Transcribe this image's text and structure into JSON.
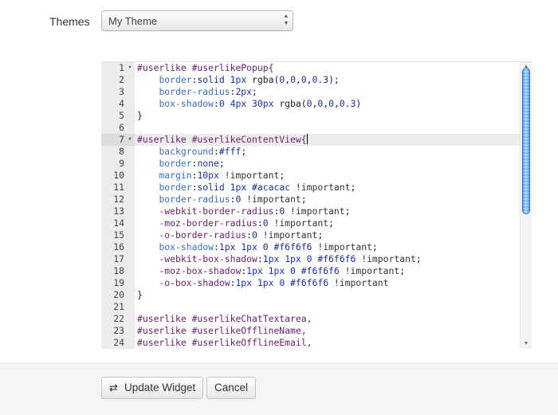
{
  "themes": {
    "label": "Themes",
    "selected": "My Theme"
  },
  "editor": {
    "lines": [
      {
        "num": "1",
        "fold": true,
        "tokens": [
          {
            "t": "sel",
            "v": "#userlike #userlikePopup{"
          }
        ]
      },
      {
        "num": "2",
        "tokens": [
          {
            "t": "plain",
            "v": "    "
          },
          {
            "t": "prop",
            "v": "border"
          },
          {
            "t": "plain",
            "v": ":"
          },
          {
            "t": "val",
            "v": "solid"
          },
          {
            "t": "plain",
            "v": " "
          },
          {
            "t": "num",
            "v": "1px"
          },
          {
            "t": "plain",
            "v": " rgba("
          },
          {
            "t": "num",
            "v": "0"
          },
          {
            "t": "plain",
            "v": ","
          },
          {
            "t": "num",
            "v": "0"
          },
          {
            "t": "plain",
            "v": ","
          },
          {
            "t": "num",
            "v": "0"
          },
          {
            "t": "plain",
            "v": ","
          },
          {
            "t": "num",
            "v": "0.3"
          },
          {
            "t": "plain",
            "v": ");"
          }
        ]
      },
      {
        "num": "3",
        "tokens": [
          {
            "t": "plain",
            "v": "    "
          },
          {
            "t": "prop",
            "v": "border-radius"
          },
          {
            "t": "plain",
            "v": ":"
          },
          {
            "t": "num",
            "v": "2px"
          },
          {
            "t": "plain",
            "v": ";"
          }
        ]
      },
      {
        "num": "4",
        "tokens": [
          {
            "t": "plain",
            "v": "    "
          },
          {
            "t": "prop",
            "v": "box-shadow"
          },
          {
            "t": "plain",
            "v": ":"
          },
          {
            "t": "num",
            "v": "0"
          },
          {
            "t": "plain",
            "v": " "
          },
          {
            "t": "num",
            "v": "4px"
          },
          {
            "t": "plain",
            "v": " "
          },
          {
            "t": "num",
            "v": "30px"
          },
          {
            "t": "plain",
            "v": " rgba("
          },
          {
            "t": "num",
            "v": "0"
          },
          {
            "t": "plain",
            "v": ","
          },
          {
            "t": "num",
            "v": "0"
          },
          {
            "t": "plain",
            "v": ","
          },
          {
            "t": "num",
            "v": "0"
          },
          {
            "t": "plain",
            "v": ","
          },
          {
            "t": "num",
            "v": "0.3"
          },
          {
            "t": "plain",
            "v": ")"
          }
        ]
      },
      {
        "num": "5",
        "tokens": [
          {
            "t": "plain",
            "v": "}"
          }
        ]
      },
      {
        "num": "6",
        "tokens": []
      },
      {
        "num": "7",
        "fold": true,
        "active": true,
        "cursor": true,
        "tokens": [
          {
            "t": "sel",
            "v": "#userlike #userlikeContentView{"
          }
        ]
      },
      {
        "num": "8",
        "tokens": [
          {
            "t": "plain",
            "v": "    "
          },
          {
            "t": "prop",
            "v": "background"
          },
          {
            "t": "plain",
            "v": ":"
          },
          {
            "t": "val",
            "v": "#fff"
          },
          {
            "t": "plain",
            "v": ";"
          }
        ]
      },
      {
        "num": "9",
        "tokens": [
          {
            "t": "plain",
            "v": "    "
          },
          {
            "t": "prop",
            "v": "border"
          },
          {
            "t": "plain",
            "v": ":"
          },
          {
            "t": "val",
            "v": "none"
          },
          {
            "t": "plain",
            "v": ";"
          }
        ]
      },
      {
        "num": "10",
        "tokens": [
          {
            "t": "plain",
            "v": "    "
          },
          {
            "t": "prop",
            "v": "margin"
          },
          {
            "t": "plain",
            "v": ":"
          },
          {
            "t": "num",
            "v": "10px"
          },
          {
            "t": "plain",
            "v": " "
          },
          {
            "t": "imp",
            "v": "!important"
          },
          {
            "t": "plain",
            "v": ";"
          }
        ]
      },
      {
        "num": "11",
        "tokens": [
          {
            "t": "plain",
            "v": "    "
          },
          {
            "t": "prop",
            "v": "border"
          },
          {
            "t": "plain",
            "v": ":"
          },
          {
            "t": "val",
            "v": "solid"
          },
          {
            "t": "plain",
            "v": " "
          },
          {
            "t": "num",
            "v": "1px"
          },
          {
            "t": "plain",
            "v": " "
          },
          {
            "t": "val",
            "v": "#acacac"
          },
          {
            "t": "plain",
            "v": " "
          },
          {
            "t": "imp",
            "v": "!important"
          },
          {
            "t": "plain",
            "v": ";"
          }
        ]
      },
      {
        "num": "12",
        "tokens": [
          {
            "t": "plain",
            "v": "    "
          },
          {
            "t": "prop",
            "v": "border-radius"
          },
          {
            "t": "plain",
            "v": ":"
          },
          {
            "t": "num",
            "v": "0"
          },
          {
            "t": "plain",
            "v": " "
          },
          {
            "t": "imp",
            "v": "!important"
          },
          {
            "t": "plain",
            "v": ";"
          }
        ]
      },
      {
        "num": "13",
        "tokens": [
          {
            "t": "plain",
            "v": "    "
          },
          {
            "t": "sel",
            "v": "-webkit-border-radius"
          },
          {
            "t": "plain",
            "v": ":"
          },
          {
            "t": "num",
            "v": "0"
          },
          {
            "t": "plain",
            "v": " "
          },
          {
            "t": "imp",
            "v": "!important"
          },
          {
            "t": "plain",
            "v": ";"
          }
        ]
      },
      {
        "num": "14",
        "tokens": [
          {
            "t": "plain",
            "v": "    "
          },
          {
            "t": "sel",
            "v": "-moz-border-radius"
          },
          {
            "t": "plain",
            "v": ":"
          },
          {
            "t": "num",
            "v": "0"
          },
          {
            "t": "plain",
            "v": " "
          },
          {
            "t": "imp",
            "v": "!important"
          },
          {
            "t": "plain",
            "v": ";"
          }
        ]
      },
      {
        "num": "15",
        "tokens": [
          {
            "t": "plain",
            "v": "    "
          },
          {
            "t": "sel",
            "v": "-o-border-radius"
          },
          {
            "t": "plain",
            "v": ":"
          },
          {
            "t": "num",
            "v": "0"
          },
          {
            "t": "plain",
            "v": " "
          },
          {
            "t": "imp",
            "v": "!important"
          },
          {
            "t": "plain",
            "v": ";"
          }
        ]
      },
      {
        "num": "16",
        "tokens": [
          {
            "t": "plain",
            "v": "    "
          },
          {
            "t": "prop",
            "v": "box-shadow"
          },
          {
            "t": "plain",
            "v": ":"
          },
          {
            "t": "num",
            "v": "1px"
          },
          {
            "t": "plain",
            "v": " "
          },
          {
            "t": "num",
            "v": "1px"
          },
          {
            "t": "plain",
            "v": " "
          },
          {
            "t": "num",
            "v": "0"
          },
          {
            "t": "plain",
            "v": " "
          },
          {
            "t": "val",
            "v": "#f6f6f6"
          },
          {
            "t": "plain",
            "v": " "
          },
          {
            "t": "imp",
            "v": "!important"
          },
          {
            "t": "plain",
            "v": ";"
          }
        ]
      },
      {
        "num": "17",
        "tokens": [
          {
            "t": "plain",
            "v": "    "
          },
          {
            "t": "sel",
            "v": "-webkit-box-shadow"
          },
          {
            "t": "plain",
            "v": ":"
          },
          {
            "t": "num",
            "v": "1px"
          },
          {
            "t": "plain",
            "v": " "
          },
          {
            "t": "num",
            "v": "1px"
          },
          {
            "t": "plain",
            "v": " "
          },
          {
            "t": "num",
            "v": "0"
          },
          {
            "t": "plain",
            "v": " "
          },
          {
            "t": "val",
            "v": "#f6f6f6"
          },
          {
            "t": "plain",
            "v": " "
          },
          {
            "t": "imp",
            "v": "!important"
          },
          {
            "t": "plain",
            "v": ";"
          }
        ]
      },
      {
        "num": "18",
        "tokens": [
          {
            "t": "plain",
            "v": "    "
          },
          {
            "t": "sel",
            "v": "-moz-box-shadow"
          },
          {
            "t": "plain",
            "v": ":"
          },
          {
            "t": "num",
            "v": "1px"
          },
          {
            "t": "plain",
            "v": " "
          },
          {
            "t": "num",
            "v": "1px"
          },
          {
            "t": "plain",
            "v": " "
          },
          {
            "t": "num",
            "v": "0"
          },
          {
            "t": "plain",
            "v": " "
          },
          {
            "t": "val",
            "v": "#f6f6f6"
          },
          {
            "t": "plain",
            "v": " "
          },
          {
            "t": "imp",
            "v": "!important"
          },
          {
            "t": "plain",
            "v": ";"
          }
        ]
      },
      {
        "num": "19",
        "tokens": [
          {
            "t": "plain",
            "v": "    "
          },
          {
            "t": "sel",
            "v": "-o-box-shadow"
          },
          {
            "t": "plain",
            "v": ":"
          },
          {
            "t": "num",
            "v": "1px"
          },
          {
            "t": "plain",
            "v": " "
          },
          {
            "t": "num",
            "v": "1px"
          },
          {
            "t": "plain",
            "v": " "
          },
          {
            "t": "num",
            "v": "0"
          },
          {
            "t": "plain",
            "v": " "
          },
          {
            "t": "val",
            "v": "#f6f6f6"
          },
          {
            "t": "plain",
            "v": " "
          },
          {
            "t": "imp",
            "v": "!important"
          }
        ]
      },
      {
        "num": "20",
        "tokens": [
          {
            "t": "plain",
            "v": "}"
          }
        ]
      },
      {
        "num": "21",
        "tokens": []
      },
      {
        "num": "22",
        "tokens": [
          {
            "t": "sel",
            "v": "#userlike #userlikeChatTextarea,"
          }
        ]
      },
      {
        "num": "23",
        "tokens": [
          {
            "t": "sel",
            "v": "#userlike #userlikeOfflineName,"
          }
        ]
      },
      {
        "num": "24",
        "tokens": [
          {
            "t": "sel",
            "v": "#userlike #userlikeOfflineEmail,"
          }
        ]
      }
    ]
  },
  "scrollbar": {
    "up_icon": "arrow-up",
    "down_icon": "arrow-down",
    "position": 0.0,
    "visible_fraction": 0.55
  },
  "actions": {
    "update_label": "Update Widget",
    "update_icon": "refresh-icon",
    "cancel_label": "Cancel"
  },
  "colors": {
    "selector": "#6b1f6b",
    "property": "#3b6fbf",
    "value": "#1b2f8e",
    "scroll_thumb": "#3b8ae8"
  }
}
